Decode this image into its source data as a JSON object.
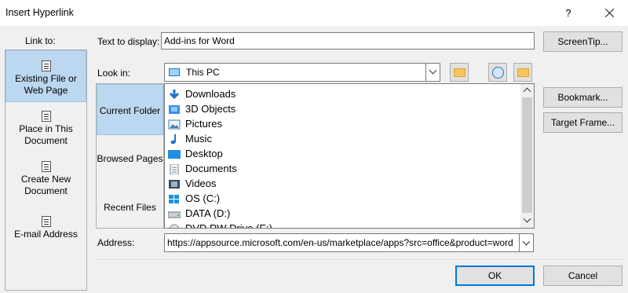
{
  "window": {
    "title": "Insert Hyperlink",
    "help_symbol": "?"
  },
  "link_to": {
    "label": "Link to:",
    "items": [
      {
        "line1": "Existing File or",
        "line2": "Web Page",
        "icon": "file-globe-icon",
        "selected": true
      },
      {
        "line1": "Place in This",
        "line2": "Document",
        "icon": "document-bookmark-icon",
        "selected": false
      },
      {
        "line1": "Create New",
        "line2": "Document",
        "icon": "new-document-icon",
        "selected": false
      },
      {
        "line1": "E-mail Address",
        "line2": "",
        "icon": "email-icon",
        "selected": false
      }
    ]
  },
  "text_to_display": {
    "label": "Text to display:",
    "value": "Add-ins for Word"
  },
  "screentip_button": "ScreenTip...",
  "look_in": {
    "label": "Look in:",
    "value": "This PC"
  },
  "side_tabs": [
    "Current Folder",
    "Browsed Pages",
    "Recent Files"
  ],
  "files": [
    {
      "name": "Downloads",
      "icon": "download-arrow-icon"
    },
    {
      "name": "3D Objects",
      "icon": "3d-objects-icon"
    },
    {
      "name": "Pictures",
      "icon": "pictures-icon"
    },
    {
      "name": "Music",
      "icon": "music-note-icon"
    },
    {
      "name": "Desktop",
      "icon": "desktop-icon"
    },
    {
      "name": "Documents",
      "icon": "documents-icon"
    },
    {
      "name": "Videos",
      "icon": "videos-icon"
    },
    {
      "name": "OS (C:)",
      "icon": "windows-drive-icon"
    },
    {
      "name": "DATA (D:)",
      "icon": "drive-icon"
    },
    {
      "name": "DVD RW Drive (E:)",
      "icon": "dvd-drive-icon"
    }
  ],
  "bookmark_button": "Bookmark...",
  "target_frame_button": "Target Frame...",
  "address": {
    "label": "Address:",
    "value": "https://appsource.microsoft.com/en-us/marketplace/apps?src=office&product=word"
  },
  "ok_button": "OK",
  "cancel_button": "Cancel",
  "colors": {
    "selection": "#bcd8f1",
    "accent": "#0078d7",
    "folder": "#f5c65d"
  }
}
